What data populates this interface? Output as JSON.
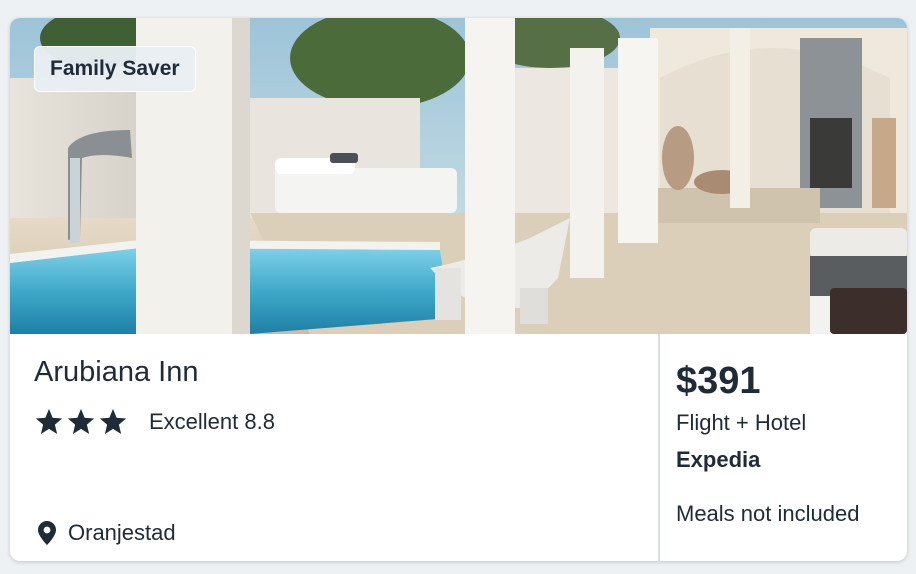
{
  "badge": {
    "label": "Family Saver"
  },
  "hotel": {
    "name": "Arubiana Inn",
    "star_rating": 3,
    "rating_text": "Excellent 8.8",
    "location": "Oranjestad"
  },
  "offer": {
    "price": "$391",
    "package": "Flight + Hotel",
    "provider": "Expedia",
    "meals": "Meals not included"
  },
  "colors": {
    "text": "#1f2b37",
    "divider": "#d7e0e8",
    "badge_bg": "#e9eef3",
    "pool": "#3fa9c9"
  },
  "icons": {
    "star": "star-icon",
    "location": "map-pin-icon"
  }
}
